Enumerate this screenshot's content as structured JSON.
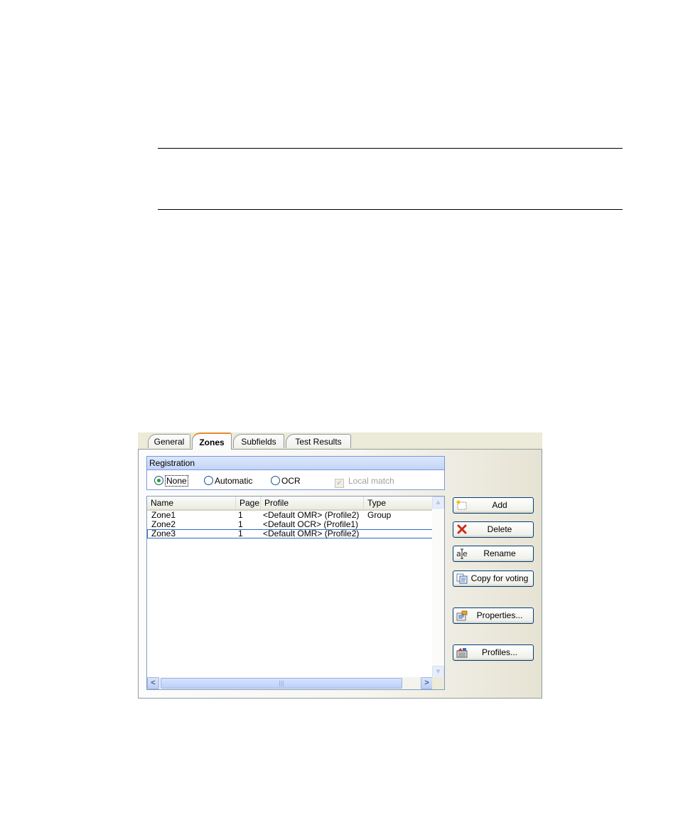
{
  "dialog": {
    "tabs": [
      {
        "label": "General"
      },
      {
        "label": "Zones"
      },
      {
        "label": "Subfields"
      },
      {
        "label": "Test Results"
      }
    ],
    "registration": {
      "title": "Registration",
      "options": [
        "None",
        "Automatic",
        "OCR"
      ],
      "selected": "None",
      "local_match_label": "Local match",
      "local_match_checked": true,
      "local_match_enabled": false
    },
    "zones_list": {
      "columns": [
        "Name",
        "Page",
        "Profile",
        "Type"
      ],
      "rows": [
        {
          "name": "Zone1",
          "page": "1",
          "profile": "<Default OMR> (Profile2)",
          "type": "Group"
        },
        {
          "name": "Zone2",
          "page": "1",
          "profile": "<Default OCR> (Profile1)",
          "type": ""
        },
        {
          "name": "Zone3",
          "page": "1",
          "profile": "<Default OMR> (Profile2)",
          "type": ""
        }
      ],
      "selected_row": "Zone3"
    },
    "buttons": {
      "add": "Add",
      "delete": "Delete",
      "rename": "Rename",
      "copy_for_voting": "Copy for voting",
      "properties": "Properties...",
      "profiles": "Profiles..."
    }
  }
}
